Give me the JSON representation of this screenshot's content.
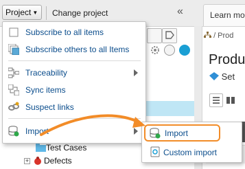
{
  "topbar": {
    "project_label": "Project",
    "change_project_label": "Change project",
    "collapse_glyph": "«",
    "right_tab_label": "Learn mo"
  },
  "menu": {
    "items": [
      {
        "label": "Subscribe to all items",
        "icon": "checkbox-icon"
      },
      {
        "label": "Subscribe others to all Items",
        "icon": "subscribe-others-icon"
      },
      {
        "label": "Traceability",
        "icon": "traceability-icon",
        "has_submenu": true
      },
      {
        "label": "Sync items",
        "icon": "sync-items-icon"
      },
      {
        "label": "Suspect links",
        "icon": "suspect-links-icon"
      },
      {
        "label": "Import",
        "icon": "import-icon",
        "has_submenu": true
      }
    ]
  },
  "submenu": {
    "items": [
      {
        "label": "Import",
        "icon": "import-icon",
        "highlighted": true
      },
      {
        "label": "Custom import",
        "icon": "custom-import-icon"
      }
    ]
  },
  "tree": {
    "rows": [
      {
        "label": "Test Cases",
        "icon": "folder-icon"
      },
      {
        "label": "Defects",
        "icon": "bug-icon"
      }
    ]
  },
  "content": {
    "breadcrumb": "/ Prod",
    "title": "Produ",
    "set_label": "Set"
  },
  "colors": {
    "menu_link": "#0b4d8c",
    "highlight": "#f28c28",
    "accent": "#0fa6d8"
  }
}
